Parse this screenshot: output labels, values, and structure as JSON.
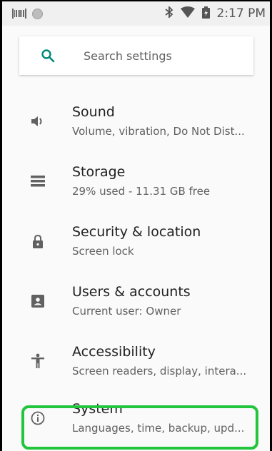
{
  "status_bar": {
    "time": "2:17 PM",
    "icons": [
      "barcode-icon",
      "circle-icon",
      "bluetooth-icon",
      "wifi-icon",
      "battery-icon"
    ]
  },
  "search": {
    "placeholder": "Search settings"
  },
  "settings": [
    {
      "icon": "volume-icon",
      "title": "Sound",
      "subtitle": "Volume, vibration, Do Not Dist..."
    },
    {
      "icon": "storage-icon",
      "title": "Storage",
      "subtitle": "29% used - 11.31 GB free"
    },
    {
      "icon": "lock-icon",
      "title": "Security & location",
      "subtitle": "Screen lock"
    },
    {
      "icon": "account-icon",
      "title": "Users & accounts",
      "subtitle": "Current user: Owner"
    },
    {
      "icon": "accessibility-icon",
      "title": "Accessibility",
      "subtitle": "Screen readers, display, intera..."
    },
    {
      "icon": "info-icon",
      "title": "System",
      "subtitle": "Languages, time, backup, upd..."
    }
  ],
  "colors": {
    "accent": "#00897b",
    "icon": "#616161",
    "highlight": "#22c53c"
  }
}
